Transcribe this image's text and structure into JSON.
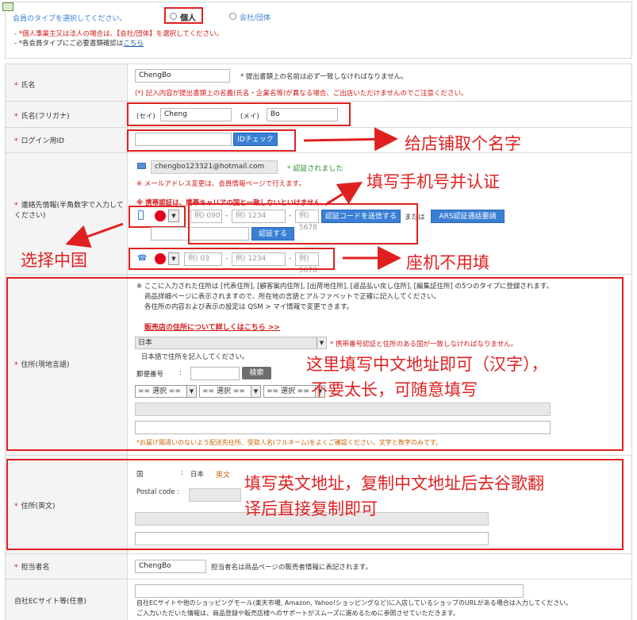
{
  "member_type": {
    "prompt": "会員のタイプを選択してください。",
    "options": [
      {
        "label": "個人",
        "selected": true
      },
      {
        "label": "会社/団体",
        "selected": false
      }
    ],
    "note1": "- *個人事業主又は法人の場合は、【会社/団体】を選択してください。",
    "note2_prefix": "- *各会員タイプにご必要書類確認は",
    "note2_link": "こちら"
  },
  "name": {
    "label": "氏名",
    "value": "ChengBo",
    "hint": "* 提出書類上の名前は必ず一致しなければなりません。",
    "warning": "(*) 記入内容が提出書類上の名義(氏名・企業名等)が異なる場合、ご出店いただけませんのでご注意ください。"
  },
  "name_kana": {
    "label": "氏名(フリガナ)",
    "sei_label": "(セイ)",
    "sei_value": "Cheng",
    "mei_label": "(メイ)",
    "mei_value": "Bo"
  },
  "login_id": {
    "label": "ログイン用ID",
    "check_button": "IDチェック",
    "annotation": "给店铺取个名字"
  },
  "contact": {
    "label": "連絡先情報(半角数字で入力してください)",
    "email": "chengbo123321@hotmail.com",
    "email_status": "* 認証されました",
    "email_note": "※ メールアドレス変更は、会員情報ページで行えます。",
    "mobile_warning": "※ 携帯認証は、携帯キャリアの国と一致しないといけません。",
    "mobile_ph1": "例) 090",
    "mobile_ph2": "例) 1234",
    "mobile_ph3": "例) 5678",
    "send_code_button": "認証コードを送信する",
    "or_text": "または",
    "ars_button": "ARS認証通話要請",
    "verify_button": "認証する",
    "phone_ph1": "例) 03",
    "phone_ph2": "例) 1234",
    "phone_ph3": "例) 5678",
    "anno_mobile": "填写手机号并认证",
    "anno_country": "选择中国",
    "anno_landline": "座机不用填"
  },
  "address_local": {
    "label": "住所(現地言語)",
    "note1": "※ ここに入力された住所は [代表住所], [顧客案内住所], [出荷地住所], [返品払い戻し住所], [編集証住所] の5つのタイプに登録されます。",
    "note2": "商品詳細ページに表示されますので、所在地の言語とアルファベットで正確に記入してください。",
    "note3": "各住所の内容および表示の設定は QSM > マイ情報で変更できます。",
    "link": "販売店の住所について詳しくはこちら >>",
    "country": "日本",
    "country_note": "* 携帯番号認証と住所のある国が一致しなければなりません。",
    "lang_note": "日本語で住所を記入してください。",
    "postal_label": "郵便番号",
    "postal_sep": ":",
    "search_button": "検索",
    "select1": "== 選択 ==",
    "select2": "== 選択 ==",
    "select3": "== 選択 ==",
    "footer_note": "*お届け間違いのないよう配送先住所、受取人名(フルネーム)をよくご確認ください。文字と数字のみです。",
    "anno_line1": "这里填写中文地址即可（汉字），",
    "anno_line2": "不要太长，可随意填写"
  },
  "address_en": {
    "label": "住所(英文)",
    "country_label": "国",
    "country_sep": ":",
    "country_value": "日本",
    "country_en": "英文",
    "postal_label": "Postal code :",
    "anno_line1": "填写英文地址，复制中文地址后去谷歌翻",
    "anno_line2": "译后直接复制即可"
  },
  "contact_person": {
    "label": "担当者名",
    "value": "ChengBo",
    "note": "担当者名は商品ページの販売者情報に表記されます。"
  },
  "ec_site": {
    "label": "自社ECサイト等(任意)",
    "note1": "自社ECサイトや他のショッピングモール(楽天市場, Amazon, Yahoo!ショッピングなど)に入店しているショップのURLがある場合は入力してください。",
    "note2": "ご入力いただいた情報は、商品登録や販売店様へのサポートがスムーズに進めるために参照させていただきます。"
  },
  "colors": {
    "accent": "#e02020",
    "button_blue": "#3a7fd5",
    "link_red": "#d31919"
  }
}
